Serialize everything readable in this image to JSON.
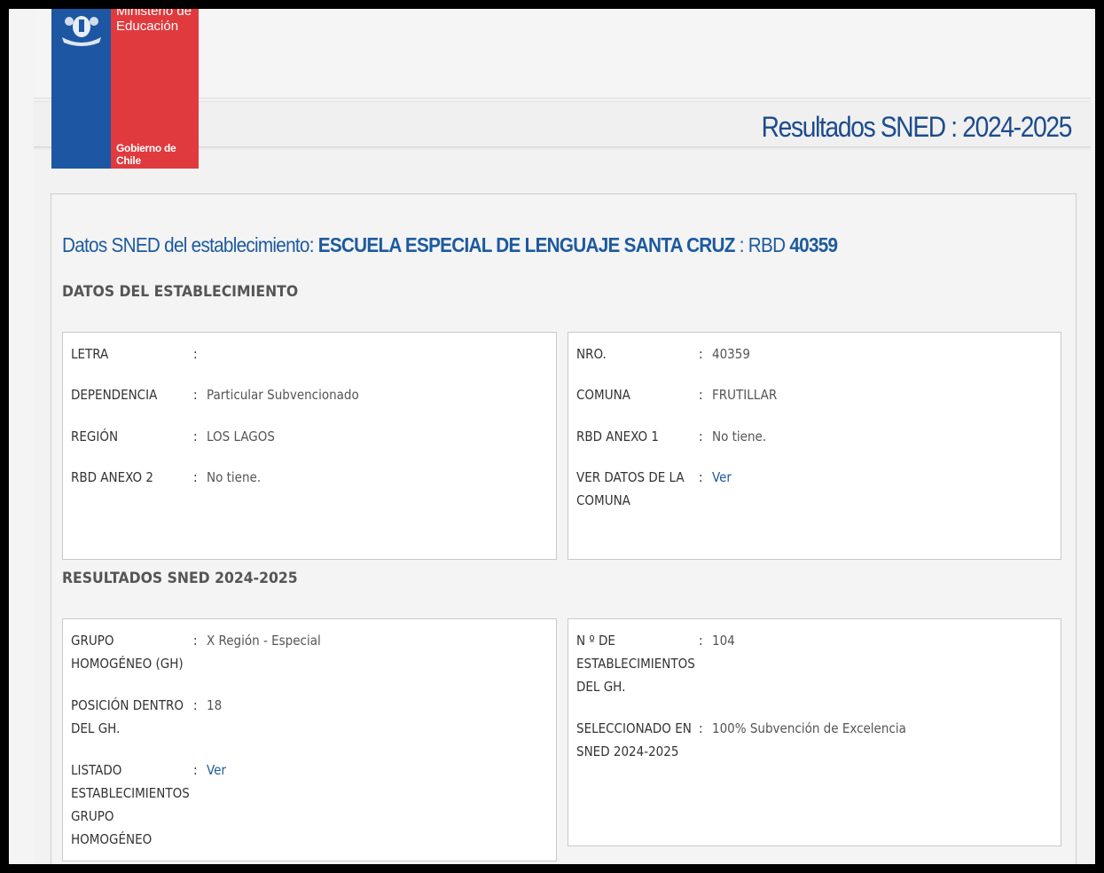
{
  "logo": {
    "ministerio_line1": "Ministerio de",
    "ministerio_line2": "Educación",
    "gobierno": "Gobierno de Chile"
  },
  "header": {
    "title": "Resultados SNED : 2024-2025"
  },
  "main": {
    "title_prefix": "Datos SNED del establecimiento: ",
    "school_name": "ESCUELA ESPECIAL DE LENGUAJE SANTA CRUZ",
    "rbd_sep": " : RBD ",
    "rbd": "40359"
  },
  "establecimiento": {
    "section_title": "DATOS DEL ESTABLECIMIENTO",
    "left": [
      {
        "label": "LETRA",
        "value": ""
      },
      {
        "label": "DEPENDENCIA",
        "value": "Particular Subvencionado"
      },
      {
        "label": "REGIÓN",
        "value": "LOS LAGOS"
      },
      {
        "label": "RBD ANEXO 2",
        "value": "No tiene."
      }
    ],
    "right": [
      {
        "label": "NRO.",
        "value": "40359"
      },
      {
        "label": "COMUNA",
        "value": "FRUTILLAR"
      },
      {
        "label": "RBD ANEXO 1",
        "value": "No tiene."
      },
      {
        "label": "VER DATOS DE LA COMUNA",
        "value": "Ver"
      }
    ]
  },
  "resultados": {
    "section_title": "RESULTADOS SNED 2024-2025",
    "left": [
      {
        "label": "GRUPO HOMOGÉNEO (GH)",
        "value": "X Región - Especial"
      },
      {
        "label": "POSICIÓN DENTRO DEL GH.",
        "value": "18"
      },
      {
        "label": "LISTADO ESTABLECIMIENTOS GRUPO HOMOGÉNEO",
        "value": "Ver"
      }
    ],
    "right": [
      {
        "label": "N º DE ESTABLECIMIENTOS DEL GH.",
        "value": "104"
      },
      {
        "label": "SELECCIONADO EN SNED 2024-2025",
        "value": "100% Subvención de Excelencia"
      }
    ]
  },
  "separator": ":"
}
